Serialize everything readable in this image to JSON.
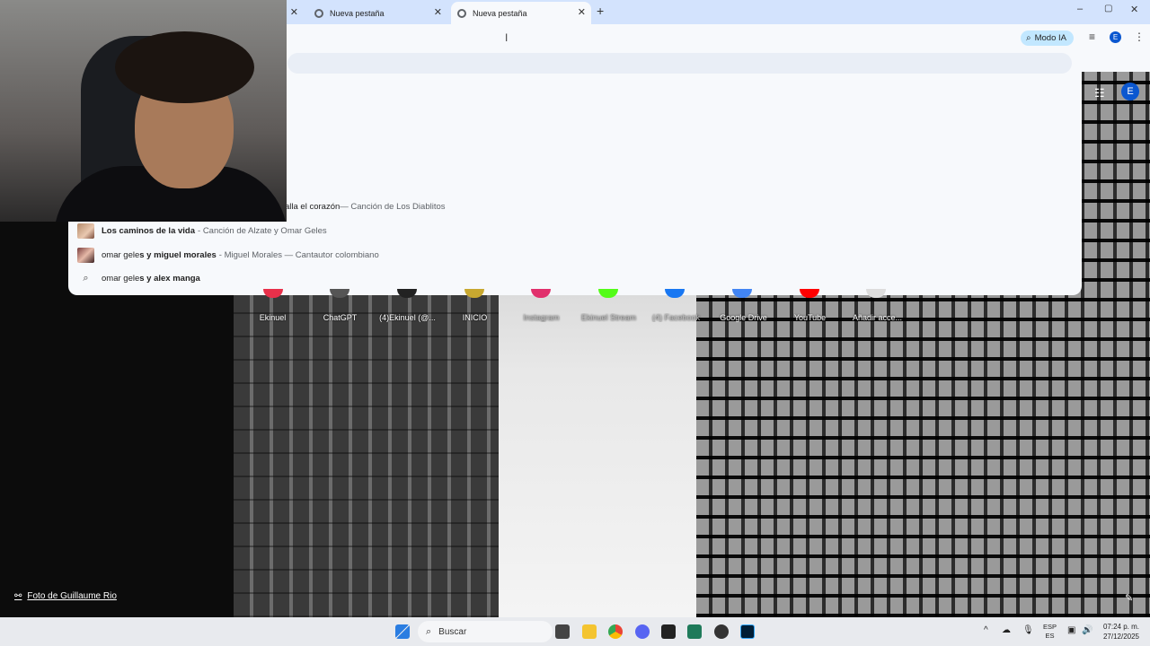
{
  "tabs": [
    {
      "title": ""
    },
    {
      "title": "Nueva pestaña"
    },
    {
      "title": "Nueva pestaña",
      "active": true
    }
  ],
  "new_tab_symbol": "+",
  "window_controls": {
    "minimize": "–",
    "maximize": "▢",
    "close": "✕"
  },
  "toolbar": {
    "ai_mode_label": "Modo IA",
    "account_initial": "E",
    "menu_symbol": "⋮"
  },
  "suggestions": [
    {
      "bold": "",
      "rest": "alla el corazón",
      "sub": " — Canción de Los Diablitos",
      "icon": "none"
    },
    {
      "bold": "Los caminos de la vida",
      "rest": "",
      "sub": " - Canción de Alzate y Omar Geles",
      "icon": "thumbnail"
    },
    {
      "prefix": "omar gele",
      "bold": "s y miguel morales",
      "sub": " - Miguel Morales — Cantautor colombiano",
      "icon": "thumbnail"
    },
    {
      "prefix": "omar gele",
      "bold": "s y alex manga",
      "sub": "",
      "icon": "search-icon"
    }
  ],
  "shortcuts": [
    {
      "label": "Ekinuel",
      "color": "#e8304a"
    },
    {
      "label": "ChatGPT",
      "color": "#444444"
    },
    {
      "label": "(4)Ekinuel (@...",
      "color": "#222222"
    },
    {
      "label": "INICIO",
      "color": "#c8a830"
    },
    {
      "label": "Instagram",
      "color": "#e1306c"
    },
    {
      "label": "Ekinuel Stream",
      "color": "#53fc18"
    },
    {
      "label": "(4) Facebook",
      "color": "#1877f2"
    },
    {
      "label": "Google Drive",
      "color": "#4285f4"
    },
    {
      "label": "YouTube",
      "color": "#ff0000"
    },
    {
      "label": "Añadir acce...",
      "color": "#dddddd"
    }
  ],
  "ntp": {
    "account_initial": "E",
    "photo_credit": "Foto de Guillaume Rio"
  },
  "taskbar": {
    "search_placeholder": "Buscar",
    "lang_line1": "ESP",
    "lang_line2": "ES",
    "time": "07:24 p. m.",
    "date": "27/12/2025"
  }
}
